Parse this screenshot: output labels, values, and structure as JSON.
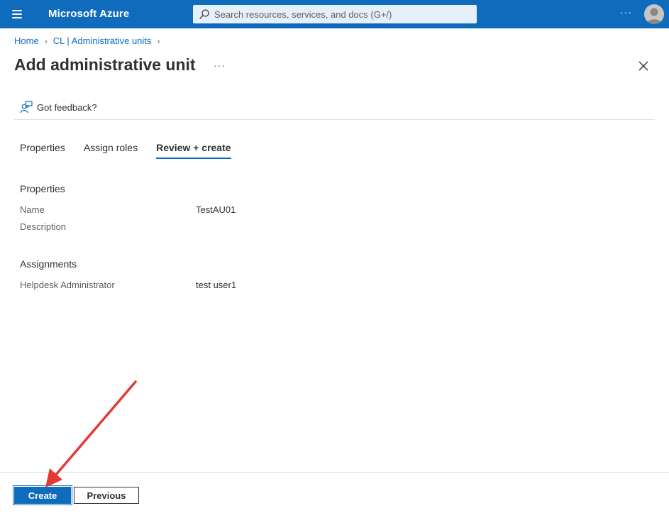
{
  "topbar": {
    "brand": "Microsoft Azure",
    "search_placeholder": "Search resources, services, and docs (G+/)",
    "more": "···"
  },
  "breadcrumb": {
    "items": [
      "Home",
      "CL | Administrative units"
    ]
  },
  "page": {
    "title": "Add administrative unit",
    "more": "···"
  },
  "feedback": {
    "label": "Got feedback?"
  },
  "tabs": [
    {
      "label": "Properties",
      "active": false
    },
    {
      "label": "Assign roles",
      "active": false
    },
    {
      "label": "Review + create",
      "active": true
    }
  ],
  "properties": {
    "title": "Properties",
    "name_label": "Name",
    "name_value": "TestAU01",
    "description_label": "Description",
    "description_value": ""
  },
  "assignments": {
    "title": "Assignments",
    "role_label": "Helpdesk Administrator",
    "role_value": "test user1"
  },
  "footer": {
    "create_label": "Create",
    "previous_label": "Previous"
  },
  "colors": {
    "accent": "#0f6cbd",
    "annotation_arrow": "#e53935"
  }
}
